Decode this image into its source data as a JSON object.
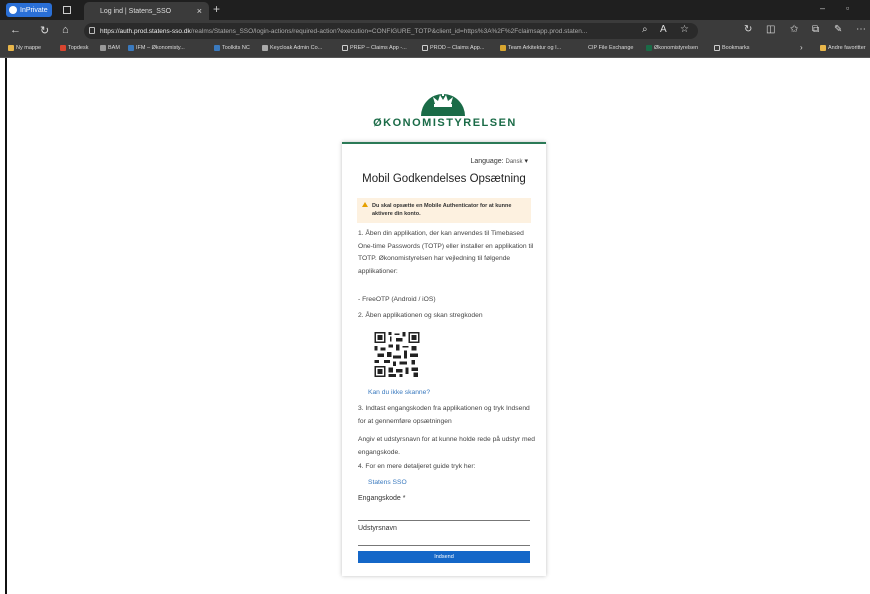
{
  "browser": {
    "inprivate_label": "InPrivate",
    "tab_title": "Log ind | Statens_SSO",
    "url_host": "https://auth.prod.statens-sso.dk",
    "url_path": "/realms/Statens_SSO/login-actions/required-action?execution=CONFIGURE_TOTP&client_id=https%3A%2F%2Fclaimsapp.prod.staten...",
    "bookmarks": [
      "Ny mappe",
      "Topdesk",
      "BAM",
      "IFM – Økonomisty...",
      "Toolkits NC",
      "Keycloak Admin Co...",
      "PREP – Claims App -...",
      "PROD – Claims App...",
      "Team Arkitektur og I...",
      "CIP File Exchange",
      "Økonomistyrelsen",
      "Bookmarks",
      "Andre favoritter"
    ],
    "colors": {
      "chrome_dark": "#1f1f1f",
      "toolbar": "#3b3b3b",
      "inprivate": "#2a6fd6"
    }
  },
  "page": {
    "logo_text": "ØKONOMISTYRELSEN",
    "language_label": "Language:",
    "language_value": "Dansk",
    "title": "Mobil Godkendelses Opsætning",
    "alert": "Du skal opsætte en Mobile Authenticator for at kunne aktivere din konto.",
    "step1": "1. Åben din applikation, der kan anvendes til Timebased One-time Passwords (TOTP) eller installer en applikation til TOTP. Økonomistyrelsen har vejledning til følgende applikationer:",
    "step1_app": "- FreeOTP (Android / iOS)",
    "step2": "2. Åben applikationen og skan stregkoden",
    "cant_scan": "Kan du ikke skanne?",
    "step3": "3. Indtast engangskoden fra applikationen og tryk Indsend for at gennemføre opsætningen",
    "step3_note": "Angiv et udstyrsnavn for at kunne holde rede på udstyr med engangskode.",
    "step4": "4. For en mere detaljeret guide tryk her:",
    "guide_link": "Statens SSO",
    "code_label": "Engangskode *",
    "device_label": "Udstyrsnavn",
    "submit": "Indsend",
    "colors": {
      "brand": "#1a6b47",
      "button": "#1467c8",
      "link": "#3a7abf",
      "alert_bg": "#fdf1e0"
    }
  }
}
